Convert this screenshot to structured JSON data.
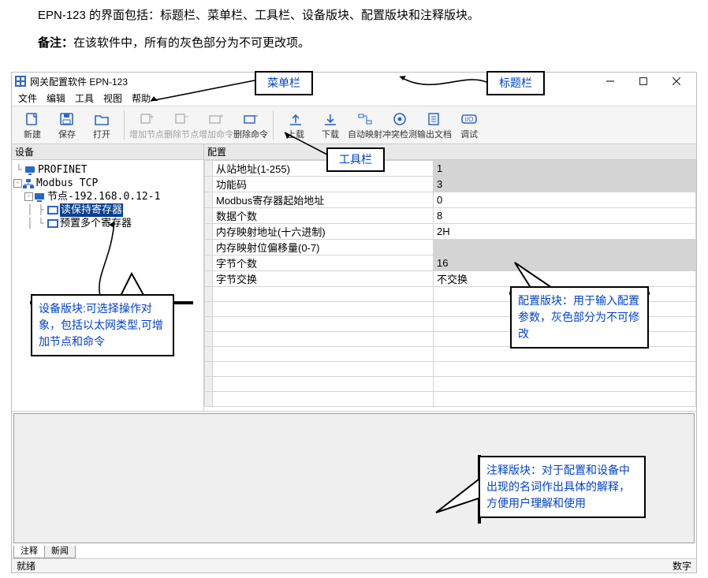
{
  "doc": {
    "intro_line": "EPN-123 的界面包括：标题栏、菜单栏、工具栏、设备版块、配置版块和注释版块。",
    "note_label": "备注：",
    "note_text": "在该软件中，所有的灰色部分为不可更改项。"
  },
  "titlebar": {
    "text": "网关配置软件 EPN-123"
  },
  "menu": {
    "items": [
      "文件",
      "编辑",
      "工具",
      "视图",
      "帮助"
    ]
  },
  "toolbar": {
    "items": [
      {
        "label": "新建",
        "icon": "new-doc",
        "enabled": true
      },
      {
        "label": "保存",
        "icon": "save",
        "enabled": true
      },
      {
        "label": "打开",
        "icon": "open",
        "enabled": true
      },
      {
        "sep": true
      },
      {
        "label": "增加节点",
        "icon": "add-node",
        "enabled": false
      },
      {
        "label": "删除节点",
        "icon": "del-node",
        "enabled": false
      },
      {
        "label": "增加命令",
        "icon": "add-cmd",
        "enabled": false
      },
      {
        "label": "删除命令",
        "icon": "del-cmd",
        "enabled": true
      },
      {
        "sep": true
      },
      {
        "label": "上载",
        "icon": "upload",
        "enabled": true
      },
      {
        "label": "下载",
        "icon": "download",
        "enabled": true
      },
      {
        "label": "自动映射",
        "icon": "auto-map",
        "enabled": true
      },
      {
        "label": "冲突检测",
        "icon": "conflict",
        "enabled": true
      },
      {
        "label": "输出文档",
        "icon": "export",
        "enabled": true
      },
      {
        "label": "调试",
        "icon": "debug",
        "enabled": true
      }
    ]
  },
  "device_panel": {
    "title": "设备",
    "tree": {
      "root": "PROFINET",
      "bus": "Modbus TCP",
      "node": "节点-192.168.0.12-1",
      "cmd1": "读保持寄存器",
      "cmd2": "预置多个寄存器"
    }
  },
  "config_panel": {
    "title": "配置",
    "rows": [
      {
        "key": "从站地址(1-255)",
        "val": "1",
        "ro": true
      },
      {
        "key": "功能码",
        "val": "3",
        "ro": true
      },
      {
        "key": "Modbus寄存器起始地址",
        "val": "0",
        "ro": false
      },
      {
        "key": "数据个数",
        "val": "8",
        "ro": false
      },
      {
        "key": "内存映射地址(十六进制)",
        "val": "2H",
        "ro": false
      },
      {
        "key": "内存映射位偏移量(0-7)",
        "val": "",
        "ro": true
      },
      {
        "key": "字节个数",
        "val": "16",
        "ro": true
      },
      {
        "key": "字节交换",
        "val": "不交换",
        "ro": false
      }
    ]
  },
  "bottom_tabs": {
    "active": "注释",
    "inactive": "新闻"
  },
  "statusbar": {
    "left": "就绪",
    "right": "数字"
  },
  "callouts": {
    "menubar": "菜单栏",
    "titlebar": "标题栏",
    "toolbar": "工具栏",
    "device": "设备版块:可选择操作对象，包括以太网类型,可增加节点和命令",
    "config": "配置版块：用于输入配置参数，灰色部分为不可修改",
    "comment": "注释版块：对于配置和设备中出现的名词作出具体的解释，方便用户理解和使用"
  }
}
